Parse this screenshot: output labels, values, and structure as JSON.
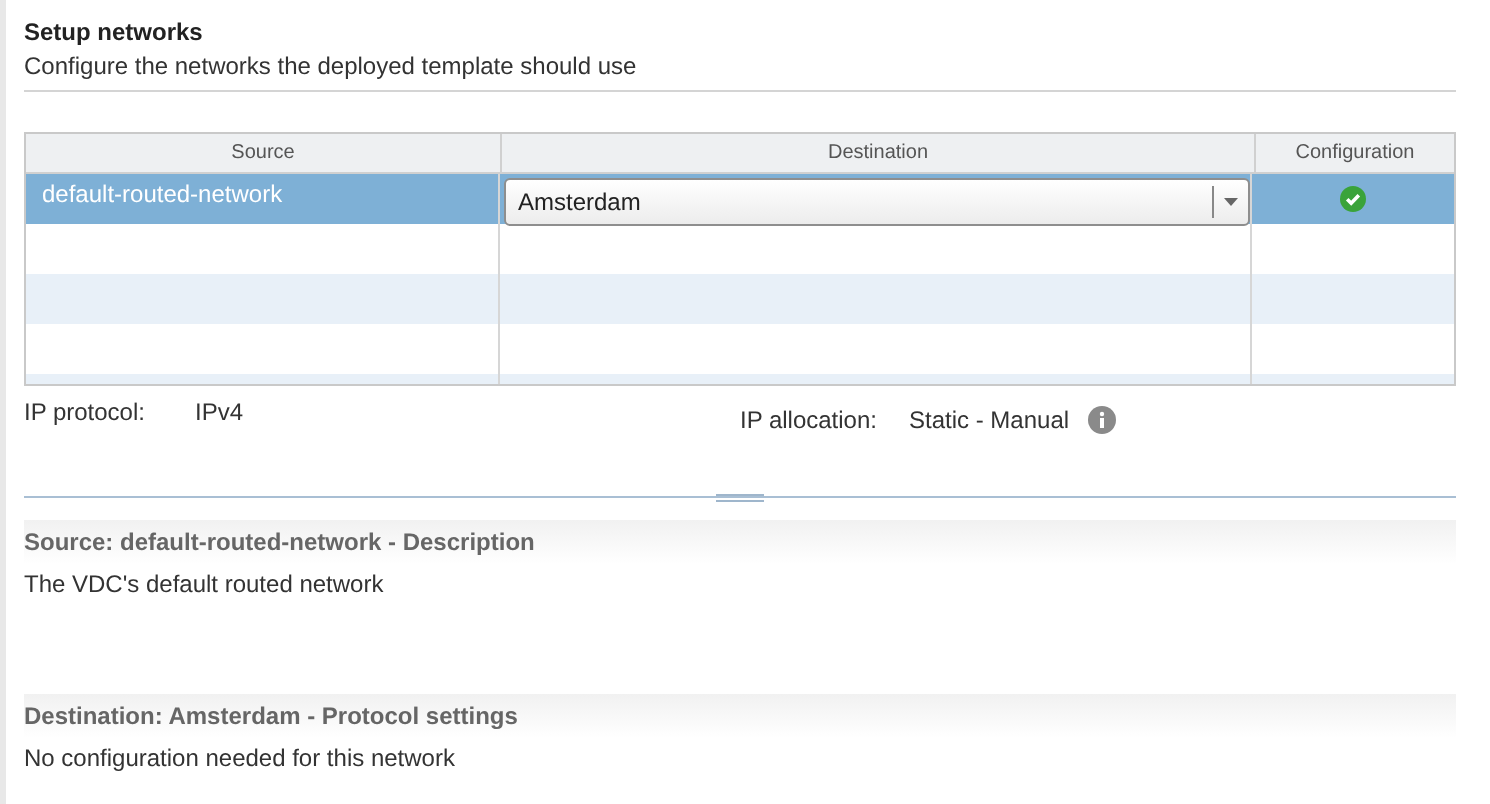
{
  "header": {
    "title": "Setup networks",
    "subtitle": "Configure the networks the deployed template should use"
  },
  "table": {
    "columns": [
      "Source",
      "Destination",
      "Configuration"
    ],
    "rows": [
      {
        "source": "default-routed-network",
        "destination": "Amsterdam",
        "configured": true,
        "selected": true
      }
    ]
  },
  "ip_protocol": {
    "label": "IP protocol:",
    "value": "IPv4"
  },
  "ip_allocation": {
    "label": "IP allocation:",
    "value": "Static - Manual"
  },
  "sections": [
    {
      "title": "Source: default-routed-network - Description",
      "text": "The VDC's default routed network"
    },
    {
      "title": "Destination: Amsterdam - Protocol settings",
      "text": "No configuration needed for this network"
    }
  ]
}
